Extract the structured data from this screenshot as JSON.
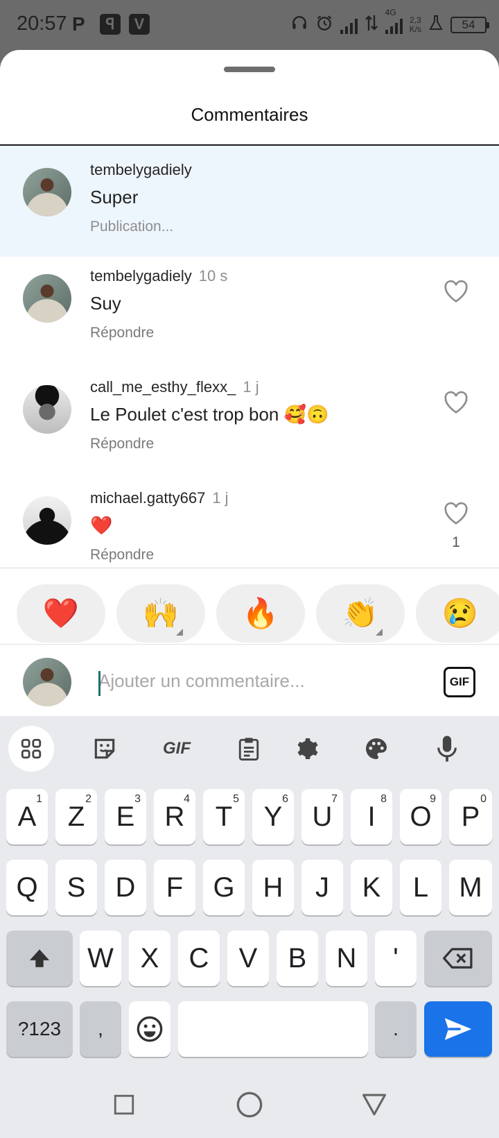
{
  "status_bar": {
    "time": "20:57",
    "network": "4G",
    "speed_value": "2,3",
    "speed_unit": "K/s",
    "battery": "54"
  },
  "sheet": {
    "title": "Commentaires"
  },
  "comments": [
    {
      "username": "tembelygadiely",
      "time": "",
      "text": "Super",
      "meta": "Publication...",
      "highlighted": true
    },
    {
      "username": "tembelygadiely",
      "time": "10 s",
      "text": "Suy",
      "meta": "Répondre"
    },
    {
      "username": "call_me_esthy_flexx_",
      "time": "1 j",
      "text": "Le Poulet c'est trop bon 🥰🙃",
      "meta": "Répondre"
    },
    {
      "username": "michael.gatty667",
      "time": "1 j",
      "text": "❤️",
      "meta": "Répondre",
      "likes": "1"
    }
  ],
  "quick_reactions": [
    "❤️",
    "🙌",
    "🔥",
    "👏",
    "😢"
  ],
  "composer": {
    "placeholder": "Ajouter un commentaire...",
    "value": "",
    "gif_label": "GIF"
  },
  "keyboard": {
    "toolbar": [
      "apps-icon",
      "sticker-icon",
      "GIF",
      "clipboard-icon",
      "settings-icon",
      "palette-icon",
      "mic-icon"
    ],
    "toolbar_gif_label": "GIF",
    "row1": [
      {
        "key": "A",
        "hint": "1"
      },
      {
        "key": "Z",
        "hint": "2"
      },
      {
        "key": "E",
        "hint": "3"
      },
      {
        "key": "R",
        "hint": "4"
      },
      {
        "key": "T",
        "hint": "5"
      },
      {
        "key": "Y",
        "hint": "6"
      },
      {
        "key": "U",
        "hint": "7"
      },
      {
        "key": "I",
        "hint": "8"
      },
      {
        "key": "O",
        "hint": "9"
      },
      {
        "key": "P",
        "hint": "0"
      }
    ],
    "row2": [
      "Q",
      "S",
      "D",
      "F",
      "G",
      "H",
      "J",
      "K",
      "L",
      "M"
    ],
    "row3": [
      "W",
      "X",
      "C",
      "V",
      "B",
      "N",
      "'"
    ],
    "symbols_label": "?123",
    "comma": ",",
    "period": "."
  },
  "colors": {
    "highlight_bg": "#eef6fd",
    "send_key": "#1a73e8",
    "keyboard_bg": "#e8eaed"
  }
}
